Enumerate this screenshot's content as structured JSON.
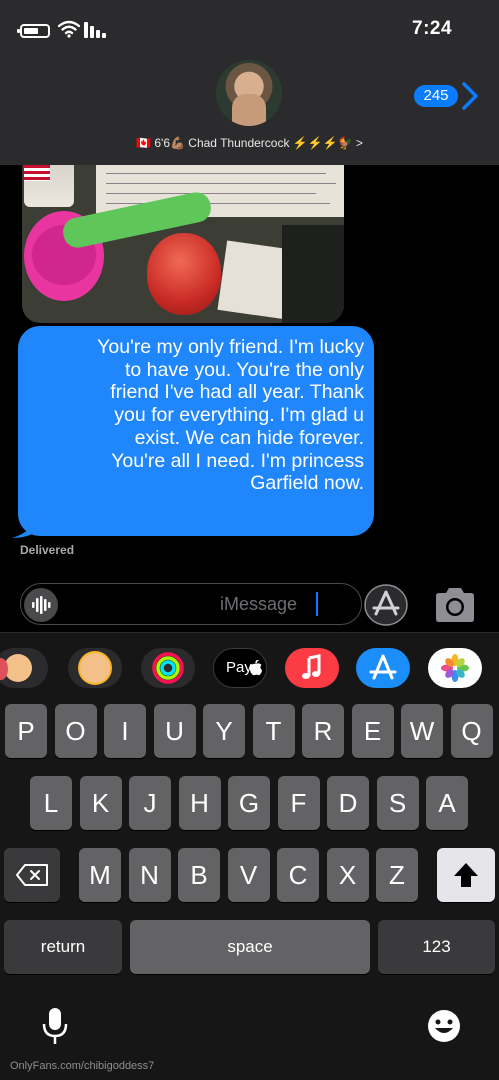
{
  "status_bar": {
    "time": "7:24"
  },
  "header": {
    "back_count": "245",
    "contact_name": "🇨🇦 6'6💪🏽 Chad Thundercock ⚡⚡⚡🐓 >"
  },
  "message": {
    "text": "You're my only friend. I'm lucky\nto have you. You're the only\nfriend I've had all year. Thank\nyou for everything. I'm glad u\nexist. We can hide forever.\nYou're all I need. I'm princess\nGarfield now.",
    "status": "Delivered"
  },
  "compose": {
    "placeholder": "iMessage"
  },
  "app_strip": {
    "items": [
      "memoji-stickers-icon",
      "animoji-icon",
      "fitness-icon",
      "apple-pay-icon",
      "music-icon",
      "app-store-icon",
      "photos-icon"
    ],
    "pay_label": "Pay"
  },
  "keyboard": {
    "row1": [
      "P",
      "O",
      "I",
      "U",
      "Y",
      "T",
      "R",
      "E",
      "W",
      "Q"
    ],
    "row2": [
      "L",
      "K",
      "J",
      "H",
      "G",
      "F",
      "D",
      "S",
      "A"
    ],
    "row3": [
      "M",
      "N",
      "B",
      "V",
      "C",
      "X",
      "Z"
    ],
    "return_label": "return",
    "space_label": "space",
    "numbers_label": "123"
  },
  "watermark": "OnlyFans.com/chibigoddess7",
  "colors": {
    "accent": "#0a7cff",
    "bubble": "#1f86fb",
    "key": "#636366",
    "background": "#000000"
  }
}
